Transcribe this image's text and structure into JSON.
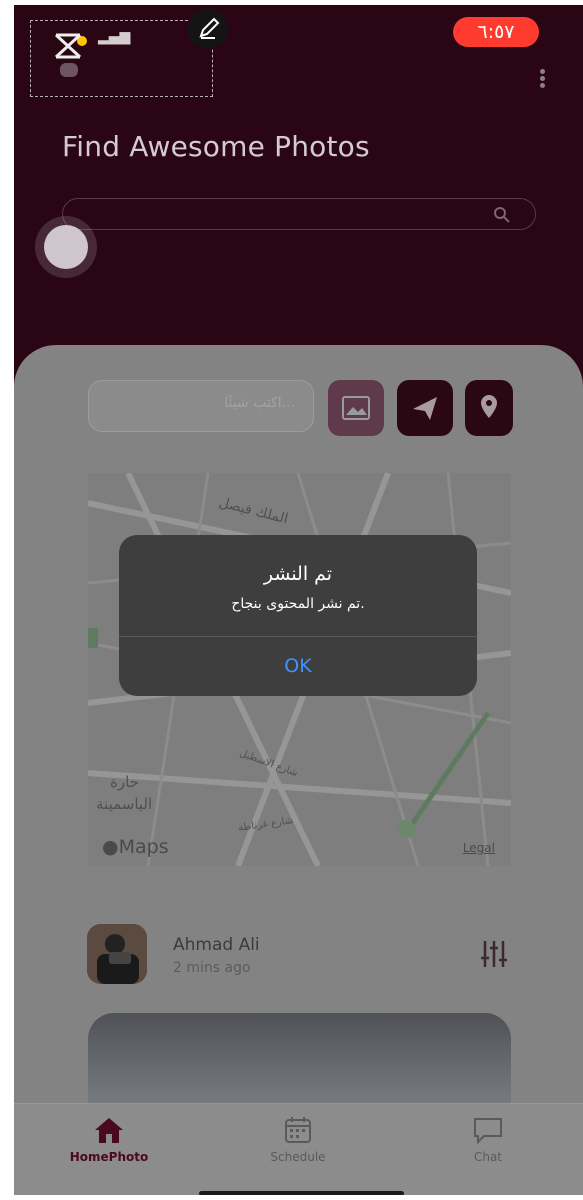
{
  "status_bar": {
    "time": "٦:٥٧"
  },
  "header": {
    "title": "Find Awesome Photos",
    "search_placeholder": ""
  },
  "composer": {
    "input_placeholder": "...اكتب شيئًا"
  },
  "map": {
    "labels": [
      "الملك فيصل",
      "حارة",
      "الياسمينة",
      "شارع الاسطبل",
      "شارع غرناطة"
    ],
    "brand": "Maps",
    "legal": "Legal"
  },
  "alert": {
    "title": "تم النشر",
    "message": "تم نشر المحتوى بنجاح.",
    "ok_label": "OK"
  },
  "post": {
    "author": "Ahmad Ali",
    "time": "2 mins ago"
  },
  "tabs": [
    {
      "label": "HomePhoto",
      "icon": "home-icon",
      "active": true
    },
    {
      "label": "Schedule",
      "icon": "calendar-icon",
      "active": false
    },
    {
      "label": "Chat",
      "icon": "chat-icon",
      "active": false
    }
  ],
  "colors": {
    "brand": "#2a0614",
    "alert_button": "#3f93ff",
    "status_pill": "#ff3b30"
  }
}
